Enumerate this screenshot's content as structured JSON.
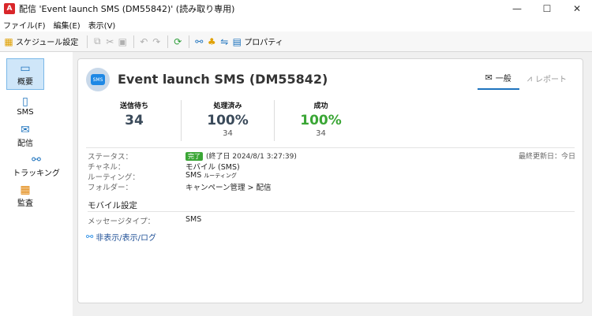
{
  "window": {
    "app_icon": "A",
    "title": "配信 'Event launch SMS (DM55842)' (読み取り専用)",
    "minimize": "—",
    "maximize": "☐",
    "close": "✕"
  },
  "menu": [
    "ファイル(F)",
    "編集(E)",
    "表示(V)"
  ],
  "toolbar": {
    "schedule_label": "スケジュール設定",
    "properties_label": "プロパティ"
  },
  "sidebar": {
    "items": [
      {
        "label": "概要",
        "icon": "overview-icon",
        "active": true
      },
      {
        "label": "SMS",
        "icon": "phone-icon"
      },
      {
        "label": "配信",
        "icon": "delivery-icon"
      },
      {
        "label": "トラッキング",
        "icon": "tracking-icon"
      },
      {
        "label": "監査",
        "icon": "audit-icon"
      }
    ]
  },
  "header": {
    "badge_text": "SMS",
    "title": "Event launch SMS (DM55842)",
    "tabs": [
      {
        "label": "一般",
        "icon": "mail-icon",
        "active": true
      },
      {
        "label": "レポート",
        "icon": "chart-icon",
        "active": false
      }
    ]
  },
  "stats": [
    {
      "label": "送信待ち",
      "value": "34",
      "sub": ""
    },
    {
      "label": "処理済み",
      "value": "100%",
      "sub": "34"
    },
    {
      "label": "成功",
      "value": "100%",
      "sub": "34"
    }
  ],
  "info": {
    "status_label": "ステータス：",
    "status_badge": "完了",
    "status_extra": "(終了日 2024/8/1 3:27:39)",
    "last_updated": "最終更新日：今日",
    "channel_label": "チャネル：",
    "channel_value": "モバイル (SMS)",
    "routing_label": "ルーティング：",
    "routing_value": "SMS",
    "routing_suffix": "ルーティング",
    "folder_label": "フォルダー：",
    "folder_value": "キャンペーン管理 > 配信"
  },
  "mobile": {
    "section_title": "モバイル設定",
    "msg_type_label": "メッセージタイプ：",
    "msg_type_value": "SMS",
    "toggle_log": "非表示/表示/ログ"
  },
  "colors": {
    "success": "#3aa635",
    "accent": "#1e73be",
    "app_red": "#d9262a"
  }
}
